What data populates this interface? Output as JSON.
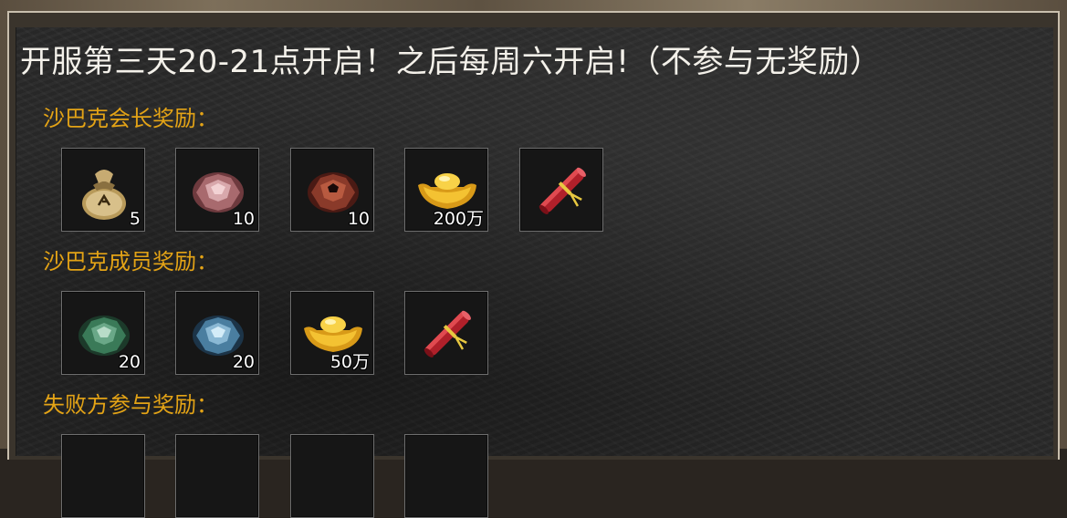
{
  "title": "开服第三天20-21点开启！之后每周六开启!（不参与无奖励）",
  "sections": [
    {
      "label": "沙巴克会长奖励：",
      "items": [
        {
          "icon": "money-bag-icon",
          "qty": "5"
        },
        {
          "icon": "pink-gem-icon",
          "qty": "10"
        },
        {
          "icon": "dark-red-gem-icon",
          "qty": "10"
        },
        {
          "icon": "gold-ingot-icon",
          "qty": "200万"
        },
        {
          "icon": "red-scroll-icon",
          "qty": ""
        }
      ]
    },
    {
      "label": "沙巴克成员奖励：",
      "items": [
        {
          "icon": "green-gem-icon",
          "qty": "20"
        },
        {
          "icon": "blue-gem-icon",
          "qty": "20"
        },
        {
          "icon": "gold-ingot-icon",
          "qty": "50万"
        },
        {
          "icon": "red-scroll-icon",
          "qty": ""
        }
      ]
    },
    {
      "label": "失败方参与奖励：",
      "items": []
    }
  ]
}
